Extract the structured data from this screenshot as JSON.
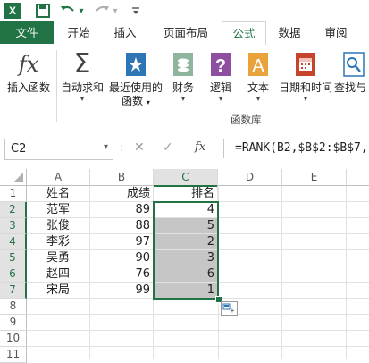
{
  "quick_access": {
    "items": [
      {
        "name": "excel-logo-icon",
        "glyph": "X"
      },
      {
        "name": "save-icon",
        "glyph": "💾"
      },
      {
        "name": "undo-icon",
        "glyph": "↶"
      },
      {
        "name": "undo-dropdown-icon",
        "glyph": "▾"
      },
      {
        "name": "redo-icon",
        "glyph": "↷"
      },
      {
        "name": "redo-dropdown-icon",
        "glyph": "▾"
      },
      {
        "name": "customize-qat-icon",
        "glyph": "⩡"
      }
    ]
  },
  "tabs": [
    "文件",
    "开始",
    "插入",
    "页面布局",
    "公式",
    "数据",
    "审阅"
  ],
  "ribbon": {
    "buttons": [
      {
        "label": "插入函数",
        "label2": "",
        "icon": "fx",
        "arrow": false
      },
      {
        "label": "自动求和",
        "label2": "",
        "icon": "Σ",
        "arrow": true
      },
      {
        "label": "最近使用的",
        "label2": "函数",
        "icon": "★",
        "arrow": true
      },
      {
        "label": "财务",
        "label2": "",
        "icon": "$",
        "arrow": true
      },
      {
        "label": "逻辑",
        "label2": "",
        "icon": "?",
        "arrow": true
      },
      {
        "label": "文本",
        "label2": "",
        "icon": "A",
        "arrow": true
      },
      {
        "label": "日期和时间",
        "label2": "",
        "icon": "▦",
        "arrow": true
      },
      {
        "label": "查找与",
        "label2": "",
        "icon": "⌕",
        "arrow": false
      }
    ],
    "group_label": "函数库",
    "icon_colors": {
      "fx": "#444444",
      "sigma": "#444444",
      "recent": "#2e75b6",
      "financial": "#3a8a5a",
      "logical": "#8e4fa1",
      "text": "#e8a33d",
      "datetime": "#c8432b",
      "lookup": "#2e75b6"
    }
  },
  "formula_bar": {
    "name_box": "C2",
    "cancel_icon": "✕",
    "enter_icon": "✓",
    "fx_label": "fx",
    "formula": "=RANK(B2,$B$2:$B$7,"
  },
  "sheet": {
    "columns": [
      "A",
      "B",
      "C",
      "D",
      "E"
    ],
    "rows": [
      "1",
      "2",
      "3",
      "4",
      "5",
      "6",
      "7",
      "8",
      "9",
      "10",
      "11",
      "12"
    ],
    "header_row": [
      "姓名",
      "成绩",
      "排名"
    ],
    "data": [
      [
        "范军",
        "89",
        "4"
      ],
      [
        "张俊",
        "88",
        "5"
      ],
      [
        "李彩",
        "97",
        "2"
      ],
      [
        "吴勇",
        "90",
        "3"
      ],
      [
        "赵四",
        "76",
        "6"
      ],
      [
        "宋局",
        "99",
        "1"
      ]
    ],
    "selected_column": "C",
    "selected_range": "C2:C7"
  },
  "colors": {
    "excel_green": "#217346",
    "selection_fill": "#c6c6c6"
  }
}
